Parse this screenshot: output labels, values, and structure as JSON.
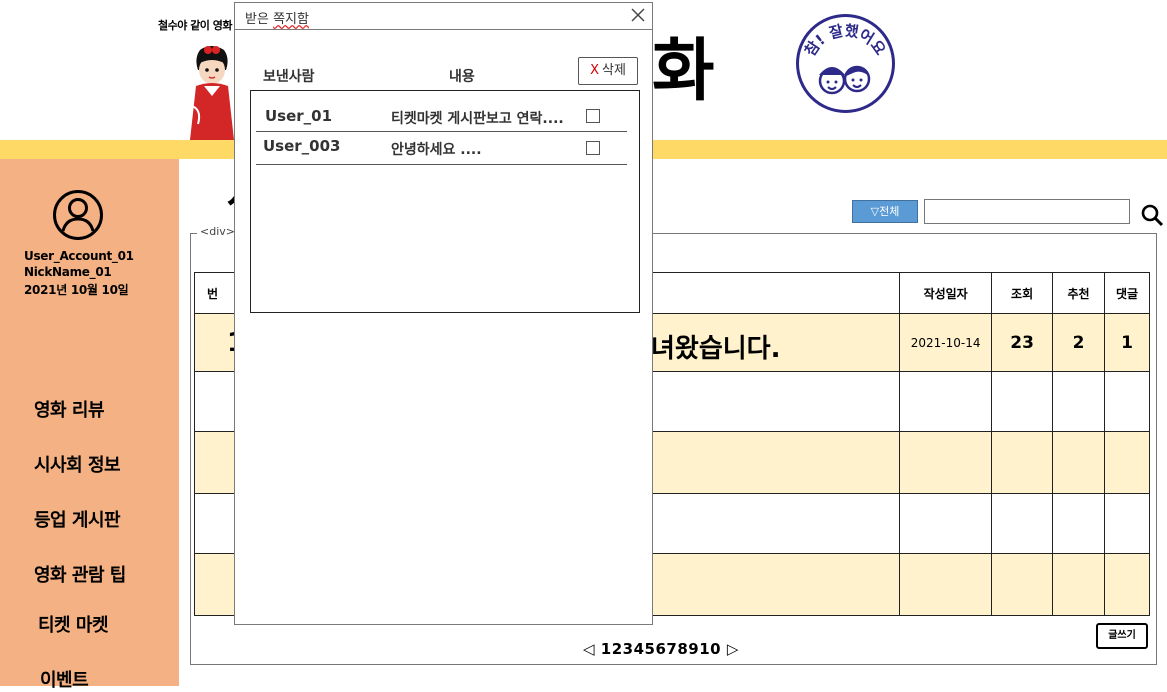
{
  "header": {
    "tagline": "철수야 같이 영화",
    "big_title": "화",
    "stamp_text": "참! 잘했어요"
  },
  "profile": {
    "account": "User_Account_01",
    "nickname": "NickName_01",
    "date": "2021년 10월 10일"
  },
  "sidebar": {
    "items": [
      {
        "label": "영화 리뷰"
      },
      {
        "label": "시사회 정보"
      },
      {
        "label": "등업 게시판"
      },
      {
        "label": "영화 관람 팁"
      },
      {
        "label": "티켓 마켓"
      },
      {
        "label": "이벤트"
      }
    ]
  },
  "main": {
    "title_partial": "사",
    "filter_label": "▽전체",
    "search_value": "",
    "div_label": "<div>"
  },
  "board": {
    "columns": {
      "number": "번",
      "date": "작성일자",
      "views": "조회",
      "recommend": "추천",
      "comments": "댓글"
    },
    "rows": [
      {
        "number": "1",
        "title": "녀왔습니다.",
        "date": "2021-10-14",
        "views": "23",
        "recommend": "2",
        "comments": "1"
      }
    ],
    "write_label": "글쓰기",
    "pager": {
      "prev": "◁",
      "pages": [
        "1",
        "2",
        "3",
        "4",
        "5",
        "6",
        "7",
        "8",
        "9",
        "10"
      ],
      "next": "▷"
    }
  },
  "modal": {
    "title_prefix": "받은 ",
    "title_underlined": "쪽지함",
    "col_sender": "보낸사람",
    "col_content": "내용",
    "delete_x": "X",
    "delete_label": "삭제",
    "messages": [
      {
        "sender": "User_01",
        "content": "티켓마켓 게시판보고 연락....",
        "checked": false
      },
      {
        "sender": "User_003",
        "content": "안녕하세요 ....",
        "checked": false
      }
    ]
  },
  "colors": {
    "header_bar": "#ffd966",
    "sidebar": "#f4b183",
    "row_highlight": "#fff2cc",
    "filter_button": "#5b9bd5",
    "stamp": "#2e2a8a"
  }
}
